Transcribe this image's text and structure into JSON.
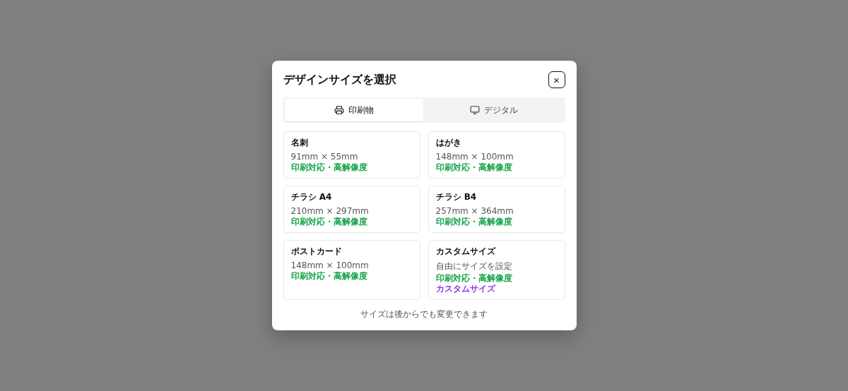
{
  "dialog": {
    "title": "デザインサイズを選択",
    "close": "×"
  },
  "tabs": [
    {
      "label": "印刷物",
      "selected": true
    },
    {
      "label": "デジタル",
      "selected": false
    }
  ],
  "sizes": [
    {
      "name": "名刺",
      "size": "91mm × 55mm",
      "tags": [
        {
          "text": "印刷対応・高解像度",
          "color": "#16a34a"
        }
      ]
    },
    {
      "name": "はがき",
      "size": "148mm × 100mm",
      "tags": [
        {
          "text": "印刷対応・高解像度",
          "color": "#16a34a"
        }
      ]
    },
    {
      "name": "チラシ A4",
      "size": "210mm × 297mm",
      "tags": [
        {
          "text": "印刷対応・高解像度",
          "color": "#16a34a"
        }
      ]
    },
    {
      "name": "チラシ B4",
      "size": "257mm × 364mm",
      "tags": [
        {
          "text": "印刷対応・高解像度",
          "color": "#16a34a"
        }
      ]
    },
    {
      "name": "ポストカード",
      "size": "148mm × 100mm",
      "tags": [
        {
          "text": "印刷対応・高解像度",
          "color": "#16a34a"
        }
      ]
    },
    {
      "name": "カスタムサイズ",
      "size": "自由にサイズを設定",
      "tags": [
        {
          "text": "印刷対応・高解像度",
          "color": "#16a34a"
        },
        {
          "text": "カスタムサイズ",
          "color": "#9333ea"
        }
      ]
    }
  ],
  "footer": "サイズは後からでも変更できます"
}
